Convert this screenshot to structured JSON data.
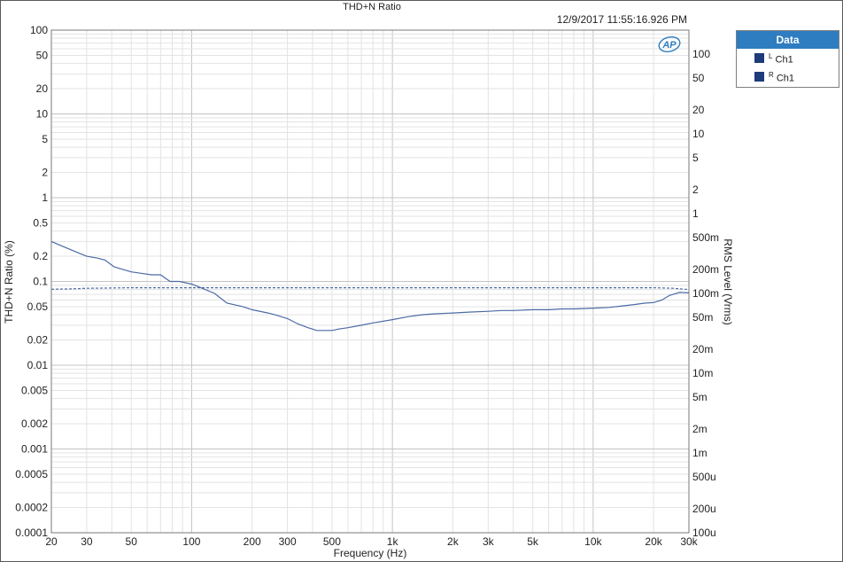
{
  "chart_data": {
    "type": "line",
    "title": "THD+N Ratio",
    "timestamp": "12/9/2017 11:55:16.926 PM",
    "xlabel": "Frequency (Hz)",
    "ylabel": "THD+N Ratio (%)",
    "y2label": "RMS Level (Vrms)",
    "xscale": "log",
    "yscale": "log",
    "xlim": [
      20,
      30000
    ],
    "ylim": [
      0.0001,
      100
    ],
    "y2lim": [
      0.0001,
      200
    ],
    "grid": true,
    "xticks": [
      {
        "v": 20,
        "t": "20"
      },
      {
        "v": 30,
        "t": "30"
      },
      {
        "v": 50,
        "t": "50"
      },
      {
        "v": 100,
        "t": "100"
      },
      {
        "v": 200,
        "t": "200"
      },
      {
        "v": 300,
        "t": "300"
      },
      {
        "v": 500,
        "t": "500"
      },
      {
        "v": 1000,
        "t": "1k"
      },
      {
        "v": 2000,
        "t": "2k"
      },
      {
        "v": 3000,
        "t": "3k"
      },
      {
        "v": 5000,
        "t": "5k"
      },
      {
        "v": 10000,
        "t": "10k"
      },
      {
        "v": 20000,
        "t": "20k"
      },
      {
        "v": 30000,
        "t": "30k"
      }
    ],
    "yticks": [
      {
        "v": 100,
        "t": "100"
      },
      {
        "v": 50,
        "t": "50"
      },
      {
        "v": 20,
        "t": "20"
      },
      {
        "v": 10,
        "t": "10"
      },
      {
        "v": 5,
        "t": "5"
      },
      {
        "v": 2,
        "t": "2"
      },
      {
        "v": 1,
        "t": "1"
      },
      {
        "v": 0.5,
        "t": "0.5"
      },
      {
        "v": 0.2,
        "t": "0.2"
      },
      {
        "v": 0.1,
        "t": "0.1"
      },
      {
        "v": 0.05,
        "t": "0.05"
      },
      {
        "v": 0.02,
        "t": "0.02"
      },
      {
        "v": 0.01,
        "t": "0.01"
      },
      {
        "v": 0.005,
        "t": "0.005"
      },
      {
        "v": 0.002,
        "t": "0.002"
      },
      {
        "v": 0.001,
        "t": "0.001"
      },
      {
        "v": 0.0005,
        "t": "0.0005"
      },
      {
        "v": 0.0002,
        "t": "0.0002"
      },
      {
        "v": 0.0001,
        "t": "0.0001"
      }
    ],
    "y2ticks": [
      {
        "v": 100,
        "t": "100"
      },
      {
        "v": 50,
        "t": "50"
      },
      {
        "v": 20,
        "t": "20"
      },
      {
        "v": 10,
        "t": "10"
      },
      {
        "v": 5,
        "t": "5"
      },
      {
        "v": 2,
        "t": "2"
      },
      {
        "v": 1,
        "t": "1"
      },
      {
        "v": 0.5,
        "t": "500m"
      },
      {
        "v": 0.2,
        "t": "200m"
      },
      {
        "v": 0.1,
        "t": "100m"
      },
      {
        "v": 0.05,
        "t": "50m"
      },
      {
        "v": 0.02,
        "t": "20m"
      },
      {
        "v": 0.01,
        "t": "10m"
      },
      {
        "v": 0.005,
        "t": "5m"
      },
      {
        "v": 0.002,
        "t": "2m"
      },
      {
        "v": 0.001,
        "t": "1m"
      },
      {
        "v": 0.0005,
        "t": "500u"
      },
      {
        "v": 0.0002,
        "t": "200u"
      },
      {
        "v": 0.0001,
        "t": "100u"
      }
    ],
    "legend": {
      "title": "Data",
      "position": "top-right"
    },
    "series": [
      {
        "name": "Ch1",
        "channel": "L",
        "axis": "left",
        "style": "solid",
        "color": "#4a6aa5",
        "x": [
          20,
          23,
          26,
          30,
          34,
          37,
          41,
          45,
          50,
          56,
          63,
          70,
          78,
          87,
          100,
          110,
          130,
          150,
          180,
          200,
          240,
          260,
          300,
          340,
          380,
          420,
          460,
          500,
          540,
          600,
          700,
          800,
          1000,
          1200,
          1400,
          1600,
          2000,
          2400,
          3000,
          3500,
          4000,
          5000,
          6000,
          7000,
          8000,
          10000,
          12000,
          14000,
          16000,
          18000,
          20000,
          22000,
          24000,
          27000,
          30000
        ],
        "y": [
          0.3,
          0.26,
          0.23,
          0.2,
          0.19,
          0.18,
          0.15,
          0.14,
          0.13,
          0.125,
          0.12,
          0.12,
          0.1,
          0.1,
          0.093,
          0.085,
          0.072,
          0.055,
          0.05,
          0.046,
          0.042,
          0.04,
          0.036,
          0.031,
          0.028,
          0.026,
          0.026,
          0.026,
          0.027,
          0.028,
          0.03,
          0.032,
          0.035,
          0.038,
          0.04,
          0.041,
          0.042,
          0.043,
          0.044,
          0.045,
          0.045,
          0.046,
          0.046,
          0.047,
          0.047,
          0.048,
          0.049,
          0.051,
          0.053,
          0.055,
          0.056,
          0.06,
          0.068,
          0.074,
          0.073
        ]
      },
      {
        "name": "Ch1",
        "channel": "R",
        "axis": "right",
        "style": "dashed",
        "color": "#4a6aa5",
        "x": [
          20,
          25,
          30,
          40,
          50,
          70,
          100,
          200,
          500,
          1000,
          2000,
          5000,
          10000,
          20000,
          25000,
          30000
        ],
        "y": [
          0.113,
          0.114,
          0.116,
          0.117,
          0.118,
          0.118,
          0.118,
          0.118,
          0.118,
          0.118,
          0.118,
          0.118,
          0.118,
          0.118,
          0.116,
          0.112
        ]
      }
    ]
  },
  "legend_items": [
    {
      "channel": "L",
      "name": "Ch1"
    },
    {
      "channel": "R",
      "name": "Ch1"
    }
  ],
  "logo": {
    "text": "AP"
  }
}
